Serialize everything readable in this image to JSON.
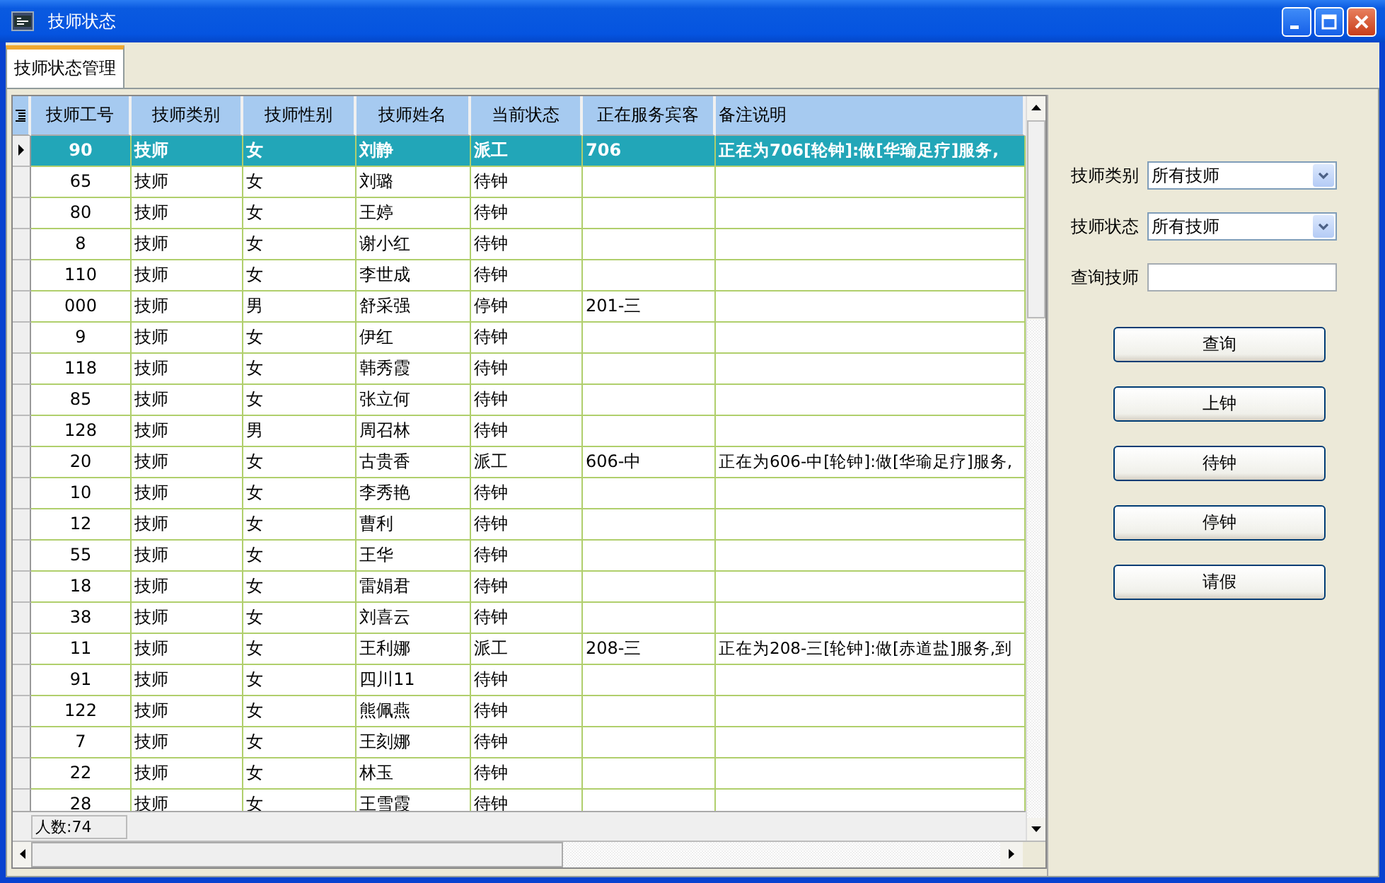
{
  "window": {
    "title": "技师状态"
  },
  "tabs": [
    {
      "label": "技师状态管理",
      "selected": true
    }
  ],
  "table": {
    "columns": [
      "技师工号",
      "技师类别",
      "技师性别",
      "技师姓名",
      "当前状态",
      "正在服务宾客",
      "备注说明"
    ],
    "rows": [
      {
        "selected": true,
        "cells": [
          "90",
          "技师",
          "女",
          "刘静",
          "派工",
          "706",
          "正在为706[轮钟]:做[华瑜足疗]服务,"
        ]
      },
      {
        "selected": false,
        "cells": [
          "65",
          "技师",
          "女",
          "刘璐",
          "待钟",
          "",
          ""
        ]
      },
      {
        "selected": false,
        "cells": [
          "80",
          "技师",
          "女",
          "王婷",
          "待钟",
          "",
          ""
        ]
      },
      {
        "selected": false,
        "cells": [
          "8",
          "技师",
          "女",
          "谢小红",
          "待钟",
          "",
          ""
        ]
      },
      {
        "selected": false,
        "cells": [
          "110",
          "技师",
          "女",
          "李世成",
          "待钟",
          "",
          ""
        ]
      },
      {
        "selected": false,
        "cells": [
          "000",
          "技师",
          "男",
          "舒采强",
          "停钟",
          "201-三",
          ""
        ]
      },
      {
        "selected": false,
        "cells": [
          "9",
          "技师",
          "女",
          "伊红",
          "待钟",
          "",
          ""
        ]
      },
      {
        "selected": false,
        "cells": [
          "118",
          "技师",
          "女",
          "韩秀霞",
          "待钟",
          "",
          ""
        ]
      },
      {
        "selected": false,
        "cells": [
          "85",
          "技师",
          "女",
          "张立何",
          "待钟",
          "",
          ""
        ]
      },
      {
        "selected": false,
        "cells": [
          "128",
          "技师",
          "男",
          "周召林",
          "待钟",
          "",
          ""
        ]
      },
      {
        "selected": false,
        "cells": [
          "20",
          "技师",
          "女",
          "古贵香",
          "派工",
          "606-中",
          "正在为606-中[轮钟]:做[华瑜足疗]服务,"
        ]
      },
      {
        "selected": false,
        "cells": [
          "10",
          "技师",
          "女",
          "李秀艳",
          "待钟",
          "",
          ""
        ]
      },
      {
        "selected": false,
        "cells": [
          "12",
          "技师",
          "女",
          "曹利",
          "待钟",
          "",
          ""
        ]
      },
      {
        "selected": false,
        "cells": [
          "55",
          "技师",
          "女",
          "王华",
          "待钟",
          "",
          ""
        ]
      },
      {
        "selected": false,
        "cells": [
          "18",
          "技师",
          "女",
          "雷娟君",
          "待钟",
          "",
          ""
        ]
      },
      {
        "selected": false,
        "cells": [
          "38",
          "技师",
          "女",
          "刘喜云",
          "待钟",
          "",
          ""
        ]
      },
      {
        "selected": false,
        "cells": [
          "11",
          "技师",
          "女",
          "王利娜",
          "派工",
          "208-三",
          "正在为208-三[轮钟]:做[赤道盐]服务,到"
        ]
      },
      {
        "selected": false,
        "cells": [
          "91",
          "技师",
          "女",
          "四川11",
          "待钟",
          "",
          ""
        ]
      },
      {
        "selected": false,
        "cells": [
          "122",
          "技师",
          "女",
          "熊佩燕",
          "待钟",
          "",
          ""
        ]
      },
      {
        "selected": false,
        "cells": [
          "7",
          "技师",
          "女",
          "王刻娜",
          "待钟",
          "",
          ""
        ]
      },
      {
        "selected": false,
        "cells": [
          "22",
          "技师",
          "女",
          "林玉",
          "待钟",
          "",
          ""
        ]
      },
      {
        "selected": false,
        "cells": [
          "28",
          "技师",
          "女",
          "王雪霞",
          "待钟",
          "",
          ""
        ]
      }
    ],
    "footer": "人数:74"
  },
  "filters": [
    {
      "kind": "dropdown",
      "label": "技师类别",
      "value": "所有技师"
    },
    {
      "kind": "dropdown",
      "label": "技师状态",
      "value": "所有技师"
    },
    {
      "kind": "text",
      "label": "查询技师"
    }
  ],
  "buttons": [
    "查询",
    "上钟",
    "待钟",
    "停钟",
    "请假"
  ]
}
